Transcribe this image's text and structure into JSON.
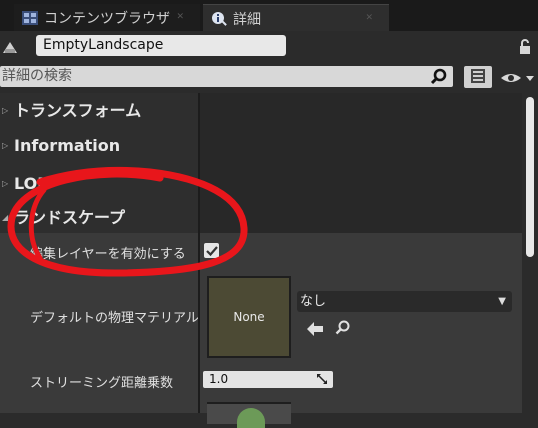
{
  "tabs": [
    {
      "label": "コンテンツブラウザ",
      "icon": "content-browser-icon",
      "active": false
    },
    {
      "label": "詳細",
      "icon": "details-info-icon",
      "active": true
    }
  ],
  "actor": {
    "name": "EmptyLandscape"
  },
  "search": {
    "placeholder": "詳細の検索"
  },
  "categories": [
    {
      "label": "トランスフォーム"
    },
    {
      "label": "Information"
    },
    {
      "label": "LOD"
    },
    {
      "label": "ランドスケープ"
    }
  ],
  "properties": {
    "edit_layers": {
      "label": "編集レイヤーを有効にする",
      "checked": true
    },
    "default_physical_material": {
      "label": "デフォルトの物理マテリアル",
      "thumbnail": "None",
      "value": "なし"
    },
    "streaming_distance_multiplier": {
      "label": "ストリーミング距離乗数",
      "value": "1.0"
    }
  },
  "colors": {
    "annotation": "#e8161b",
    "accent": "#e8e8e8"
  }
}
